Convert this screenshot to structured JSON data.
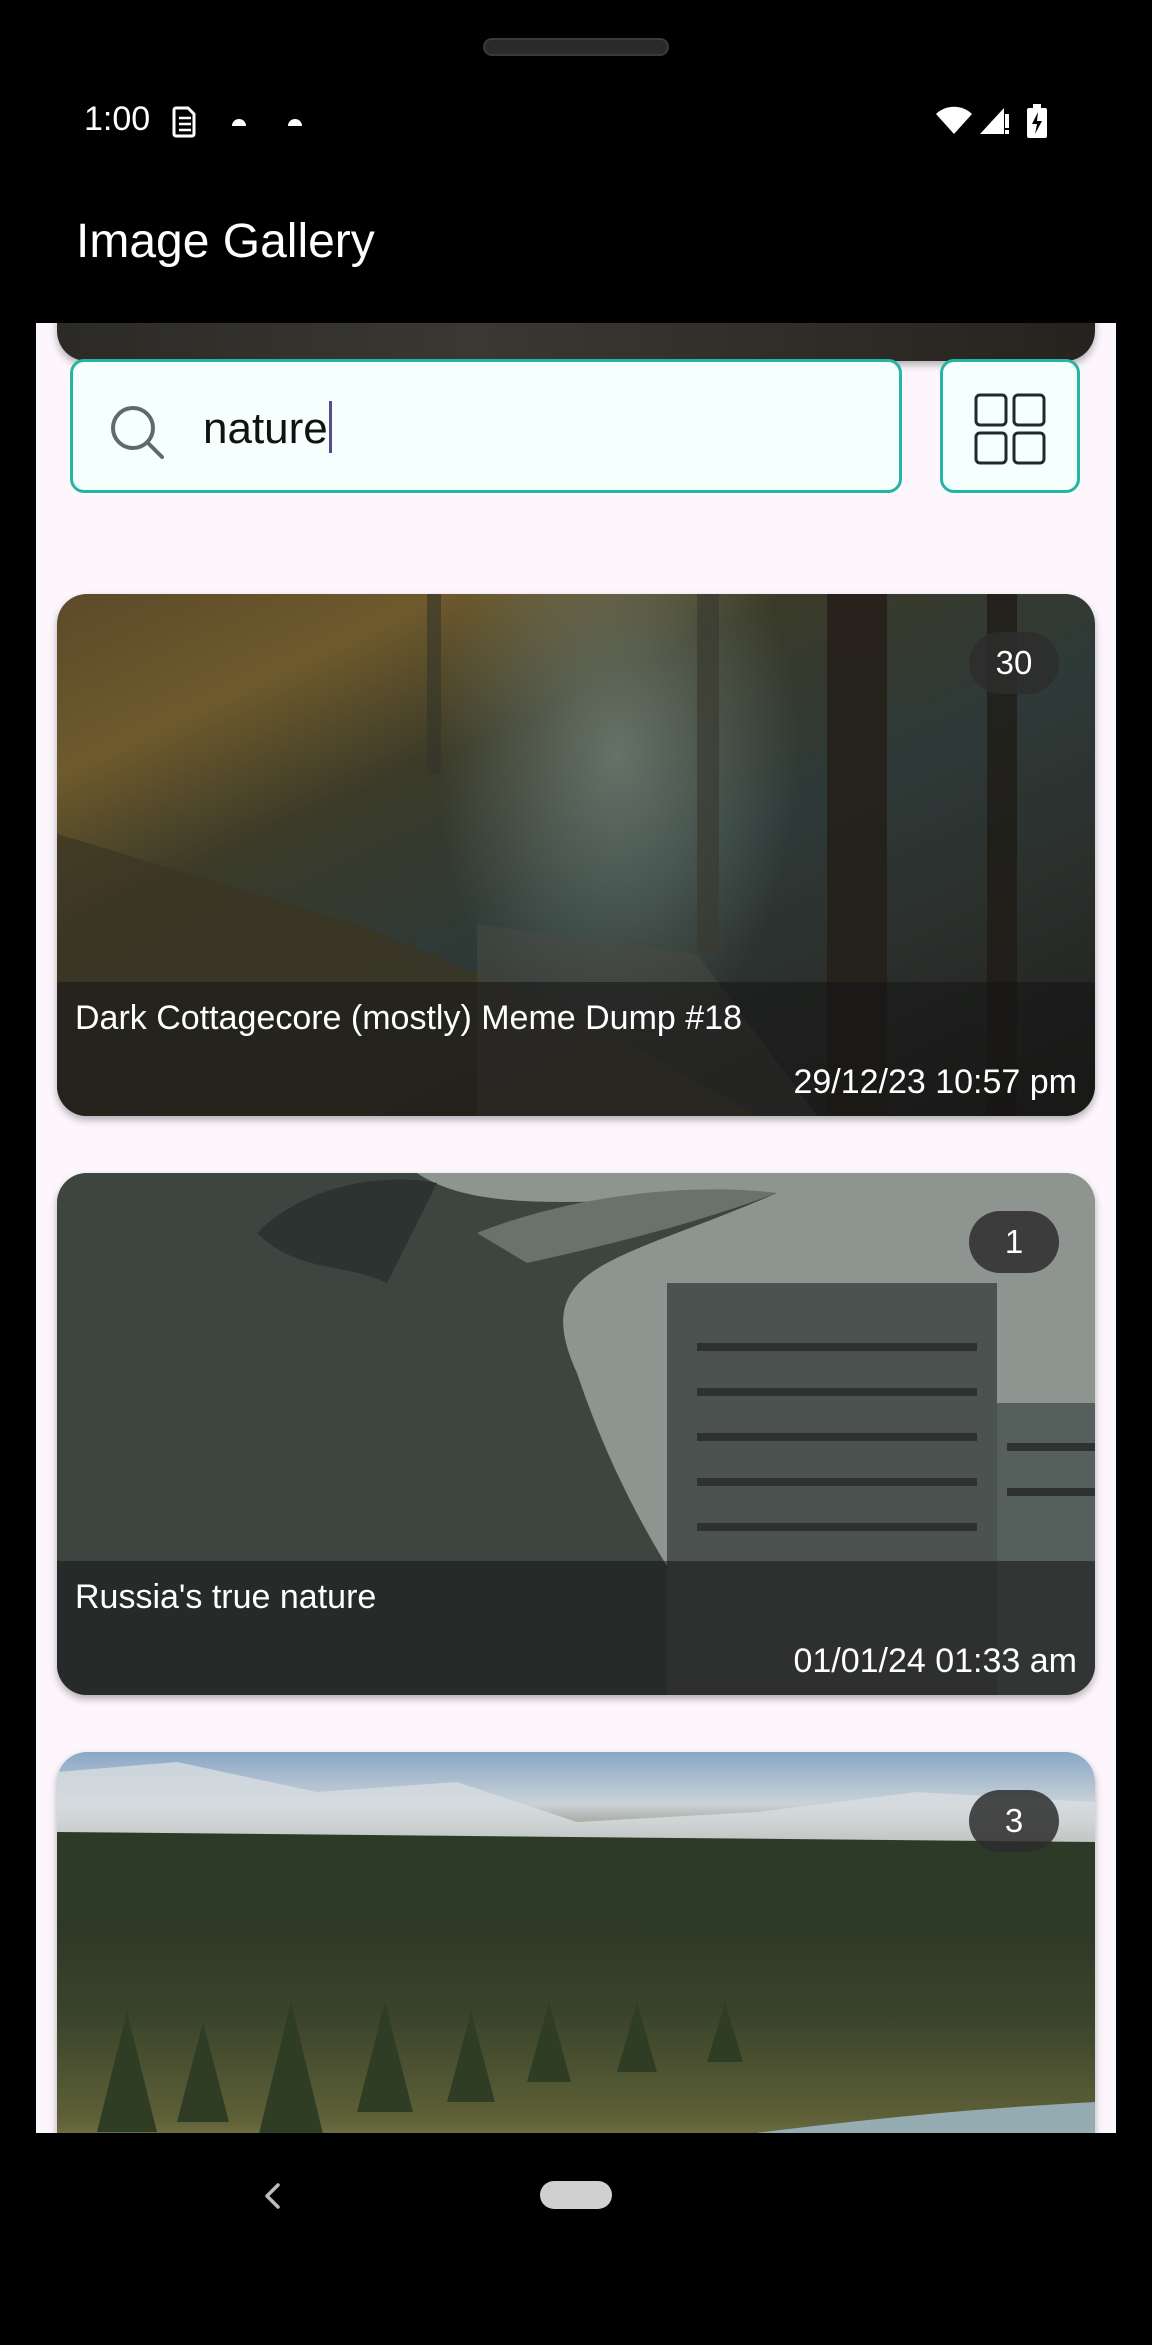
{
  "status_bar": {
    "time": "1:00",
    "icons": [
      "sim-icon",
      "notification-dot-icon",
      "notification-dot-icon",
      "wifi-icon",
      "signal-icon",
      "battery-charging-icon"
    ]
  },
  "app_bar": {
    "title": "Image Gallery"
  },
  "search": {
    "value": "nature",
    "icon": "search-icon"
  },
  "grid_toggle": {
    "icon": "grid-view-icon"
  },
  "cards": [
    {
      "title": "Dark Cottagecore (mostly) Meme Dump #18",
      "date": "29/12/23 10:57 pm",
      "count": "30",
      "image": "misty-forest-photo"
    },
    {
      "title": "Russia's true nature",
      "date": "01/01/24 01:33 am",
      "count": "1",
      "image": "pig-building-photo"
    },
    {
      "title": "",
      "date": "",
      "count": "3",
      "image": "pine-lake-landscape-photo"
    }
  ],
  "colors": {
    "accent": "#26b5a5",
    "surface": "#fdf7fd",
    "badge": "#2d2d2d"
  },
  "nav_bar": {
    "icons": [
      "back-icon",
      "home-icon"
    ]
  }
}
